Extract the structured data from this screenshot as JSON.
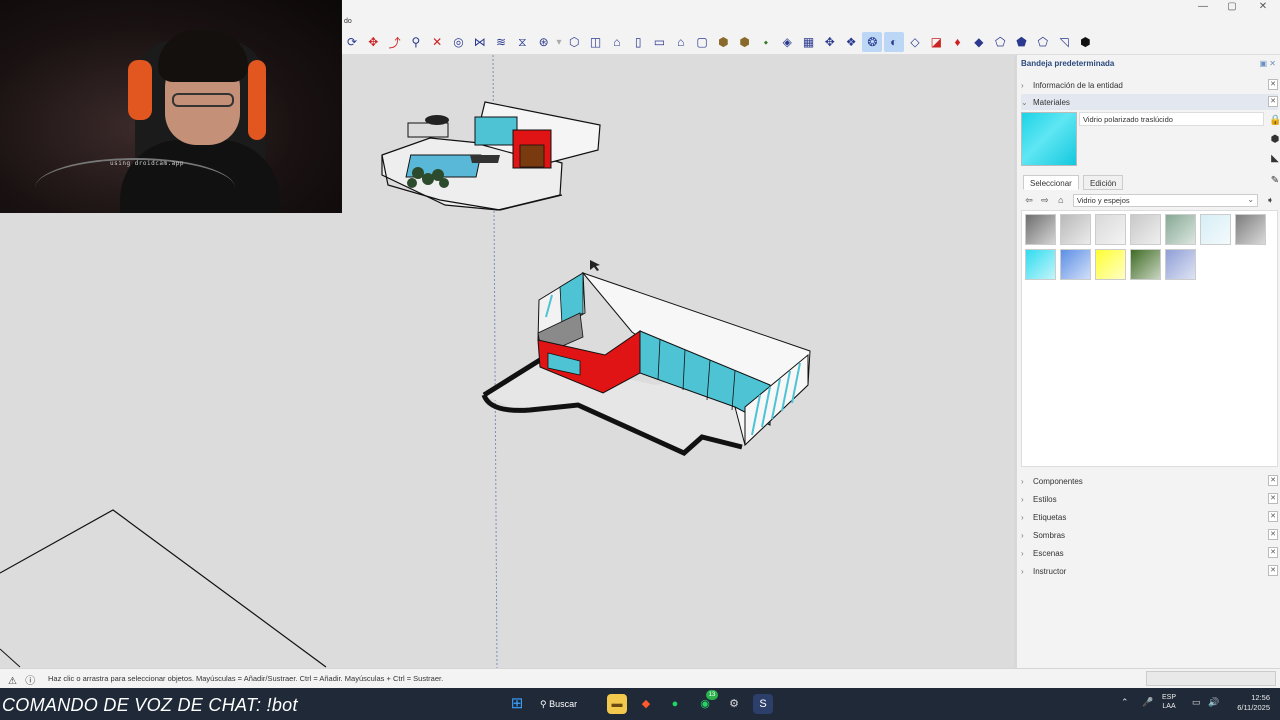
{
  "titlebar": {
    "menu_fragment": "do",
    "minimize": "—",
    "maximize": "▢",
    "close": "✕"
  },
  "webcam": {
    "shirt_text": "using droidcam.app"
  },
  "toolbar": {
    "icons": [
      "orbit-icon",
      "pan-icon",
      "walk-icon",
      "zoom-icon",
      "zoom-extents-icon",
      "section-plane-icon",
      "section-display-icon",
      "section-fill-icon",
      "layers-icon",
      "position-camera-icon",
      "iso-view-icon",
      "top-view-icon",
      "front-view-icon",
      "right-view-icon",
      "back-view-icon",
      "left-view-icon",
      "component-icon",
      "group-icon",
      "paint-icon",
      "follow-me-icon",
      "outer-shell-icon",
      "xray-icon",
      "back-edges-icon",
      "wireframe-icon",
      "hidden-line-icon",
      "shaded-icon",
      "shaded-textures-icon",
      "monochrome-icon",
      "sandbox-icon",
      "terrain-icon",
      "stamp-icon",
      "drape-icon",
      "add-detail-icon",
      "flip-edge-icon",
      "extension-icon"
    ]
  },
  "panel": {
    "title": "Bandeja predeterminada",
    "entity_info": "Información de la entidad",
    "materials": "Materiales",
    "material_name": "Vidrio polarizado traslúcido",
    "tab_select": "Seleccionar",
    "tab_edit": "Edición",
    "library": "Vidrio y espejos",
    "sections": [
      "Componentes",
      "Estilos",
      "Etiquetas",
      "Sombras",
      "Escenas",
      "Instructor"
    ],
    "swatch_colors": [
      "#6e6e6e",
      "#b9b9b9",
      "#d9d9d9",
      "#c8c8c8",
      "#86a894",
      "#d6eef6",
      "#7d7d7d",
      "#2fdcef",
      "#5d8fe6",
      "#ffff33",
      "#3f6c24",
      "#8f9fd6"
    ]
  },
  "statusbar": {
    "hint": "Haz clic o arrastra para seleccionar objetos. Mayúsculas = Añadir/Sustraer. Ctrl = Añadir. Mayúsculas + Ctrl = Sustraer."
  },
  "taskbar": {
    "chat_command": "COMANDO DE VOZ DE CHAT: !bot",
    "search_label": "Buscar",
    "lang_line1": "ESP",
    "lang_line2": "LAA",
    "time": "12:56",
    "date": "6/11/2025",
    "whatsapp_badge": "13"
  },
  "colors": {
    "accent_red": "#e01414",
    "glass": "#4ec3d4",
    "panel_title": "#2c4a7e"
  }
}
